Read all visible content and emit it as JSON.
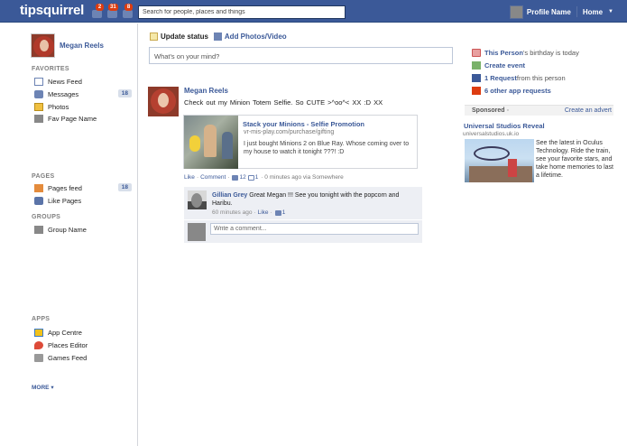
{
  "topbar": {
    "logo": "tipsquirrel",
    "badges": [
      "2",
      "31",
      "8"
    ],
    "search_placeholder": "Search for people, places and things",
    "profile_label": "Profile Name",
    "home_label": "Home",
    "color": "#3b5998"
  },
  "sidebar": {
    "profile_name": "Megan Reels",
    "favourites_heading": "FAVORITES",
    "favourites": [
      {
        "label": "News Feed",
        "icon": "news-feed-icon"
      },
      {
        "label": "Messages",
        "icon": "messages-icon",
        "count": "18"
      },
      {
        "label": "Photos",
        "icon": "photos-icon"
      },
      {
        "label": "Fav Page Name",
        "icon": "page-placeholder-icon"
      }
    ],
    "pages_heading": "PAGES",
    "pages": [
      {
        "label": "Pages feed",
        "icon": "pages-feed-icon",
        "count": "18"
      },
      {
        "label": "Like Pages",
        "icon": "like-pages-icon"
      }
    ],
    "groups_heading": "GROUPS",
    "groups": [
      {
        "label": "Group Name",
        "icon": "group-placeholder-icon"
      }
    ],
    "apps_heading": "APPS",
    "apps": [
      {
        "label": "App Centre",
        "icon": "app-centre-icon"
      },
      {
        "label": "Places Editor",
        "icon": "places-editor-icon"
      },
      {
        "label": "Games Feed",
        "icon": "games-feed-icon"
      }
    ],
    "more_label": "MORE"
  },
  "composer": {
    "update_status": "Update status",
    "add_photos": "Add Photos/Video",
    "placeholder": "What's on your mind?"
  },
  "post": {
    "author": "Megan Reels",
    "text": "Check out my Minion Totem Selfie. So CUTE    >^oo^<    XX :D XX",
    "link": {
      "title": "Stack your Minions - Selfie Promotion",
      "url": "vr-mis-play.com/purchase/gifting",
      "description": "I just bought Minions 2 on Blue Ray. Whose coming over to my house to watch it tonight ???! :D"
    },
    "actions": {
      "like": "Like",
      "sep": "·",
      "comment": "Comment",
      "like_count": "12",
      "comment_count": "1",
      "time": "· 0 minutes ago via Somewhere"
    },
    "comment": {
      "author": "Gillian Grey",
      "text": "Great Megan !!! See you tonight with the popcorn and Haribu.",
      "time": "60 minutes ago",
      "like": "Like",
      "like_count": "1"
    },
    "reply_placeholder": "Write a comment..."
  },
  "right": {
    "birthday_name": "This Person",
    "birthday_rest": "'s birthday is today",
    "create_event": "Create event",
    "request_bold": "1 Request",
    "request_rest": " from this person",
    "app_requests": "6 other app requests",
    "sponsored": "Sponsored",
    "create_advert": "Create an advert",
    "ad_title": "Universal Studios Reveal",
    "ad_url": "universalstudios.uk.io",
    "ad_desc": "See the latest in Oculus Technology. Ride the train, see your favorite stars, and take home memories to last a lifetime."
  }
}
